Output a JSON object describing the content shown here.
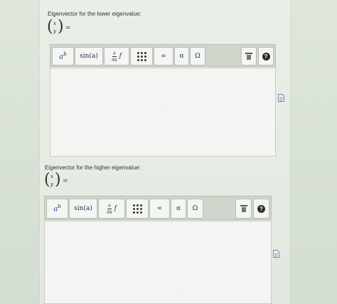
{
  "lower": {
    "prompt": "Eigenvector for the lower eigenvalue:",
    "vector_top": "x",
    "vector_bottom": "y",
    "equals": "="
  },
  "higher": {
    "prompt": "Eigenvector for the higher eigenvalue:",
    "vector_top": "x",
    "vector_bottom": "y",
    "equals": "="
  },
  "toolbar": {
    "power_base": "a",
    "power_exp": "b",
    "sin_label": "sin(a)",
    "deriv_num": "∂",
    "deriv_den": "∂x",
    "deriv_f": "f",
    "infinity": "∞",
    "alpha": "α",
    "omega": "Ω",
    "help": "?"
  },
  "icons": [
    "matrix-icon",
    "trash-icon",
    "help-icon",
    "document-icon"
  ]
}
